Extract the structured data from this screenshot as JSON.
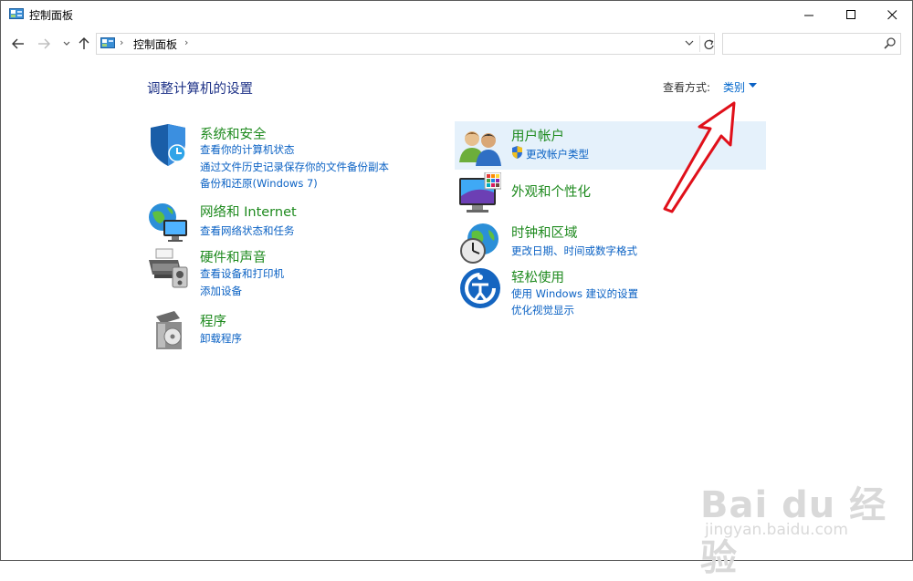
{
  "window": {
    "title": "控制面板"
  },
  "address": {
    "crumb": "控制面板"
  },
  "search": {
    "placeholder": ""
  },
  "content": {
    "heading": "调整计算机的设置",
    "view_by_label": "查看方式:",
    "view_by_value": "类别"
  },
  "categories": [
    {
      "title": "系统和安全",
      "links": [
        "查看你的计算机状态",
        "通过文件历史记录保存你的文件备份副本",
        "备份和还原(Windows 7)"
      ]
    },
    {
      "title": "网络和 Internet",
      "links": [
        "查看网络状态和任务"
      ]
    },
    {
      "title": "硬件和声音",
      "links": [
        "查看设备和打印机",
        "添加设备"
      ]
    },
    {
      "title": "程序",
      "links": [
        "卸载程序"
      ]
    },
    {
      "title": "用户帐户",
      "links": [
        "更改帐户类型"
      ]
    },
    {
      "title": "外观和个性化",
      "links": []
    },
    {
      "title": "时钟和区域",
      "links": [
        "更改日期、时间或数字格式"
      ]
    },
    {
      "title": "轻松使用",
      "links": [
        "使用 Windows 建议的设置",
        "优化视觉显示"
      ]
    }
  ],
  "watermark": {
    "logo": "Bai du 经验",
    "url": "jingyan.baidu.com"
  },
  "colors": {
    "heading": "#1e3287",
    "category_title": "#1e8a1e",
    "link": "#0b62c4",
    "arrow": "#e0101a",
    "highlight": "#e5f1fb"
  },
  "icons": [
    "control-panel-icon",
    "back-arrow-icon",
    "forward-arrow-icon",
    "recent-dropdown-icon",
    "up-arrow-icon",
    "refresh-icon",
    "search-icon",
    "minimize-icon",
    "maximize-icon",
    "close-icon",
    "shield-icon",
    "network-globe-icon",
    "printer-icon",
    "programs-icon",
    "users-icon",
    "monitor-palette-icon",
    "clock-globe-icon",
    "accessibility-icon",
    "uac-shield-icon"
  ]
}
